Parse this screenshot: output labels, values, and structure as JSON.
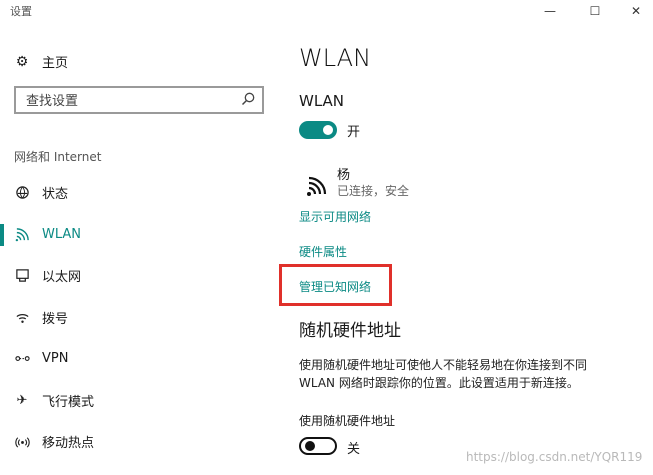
{
  "window": {
    "title": "设置",
    "controls": {
      "minimize": "—",
      "maximize": "☐",
      "close": "✕"
    }
  },
  "sidebar": {
    "home_label": "主页",
    "search_placeholder": "查找设置",
    "section_header": "网络和 Internet",
    "items": [
      {
        "label": "状态",
        "icon": "status-icon"
      },
      {
        "label": "WLAN",
        "icon": "wifi-icon",
        "active": true
      },
      {
        "label": "以太网",
        "icon": "ethernet-icon"
      },
      {
        "label": "拨号",
        "icon": "dialup-icon"
      },
      {
        "label": "VPN",
        "icon": "vpn-icon"
      },
      {
        "label": "飞行模式",
        "icon": "airplane-icon"
      },
      {
        "label": "移动热点",
        "icon": "hotspot-icon"
      }
    ]
  },
  "main": {
    "title": "WLAN",
    "wlan_label": "WLAN",
    "wlan_toggle": {
      "state_label": "开",
      "on": true
    },
    "network": {
      "name": "杨",
      "status": "已连接，安全"
    },
    "links": {
      "show_available": "显示可用网络",
      "hardware_props": "硬件属性",
      "manage_known": "管理已知网络"
    },
    "random_hw": {
      "title": "随机硬件地址",
      "description": "使用随机硬件地址可使他人不能轻易地在你连接到不同 WLAN 网络时跟踪你的位置。此设置适用于新连接。",
      "option_label": "使用随机硬件地址",
      "toggle": {
        "state_label": "关",
        "on": false
      }
    }
  },
  "watermark": "https://blog.csdn.net/YQR119",
  "colors": {
    "accent": "#0b8a84",
    "highlight": "#e0302a"
  }
}
